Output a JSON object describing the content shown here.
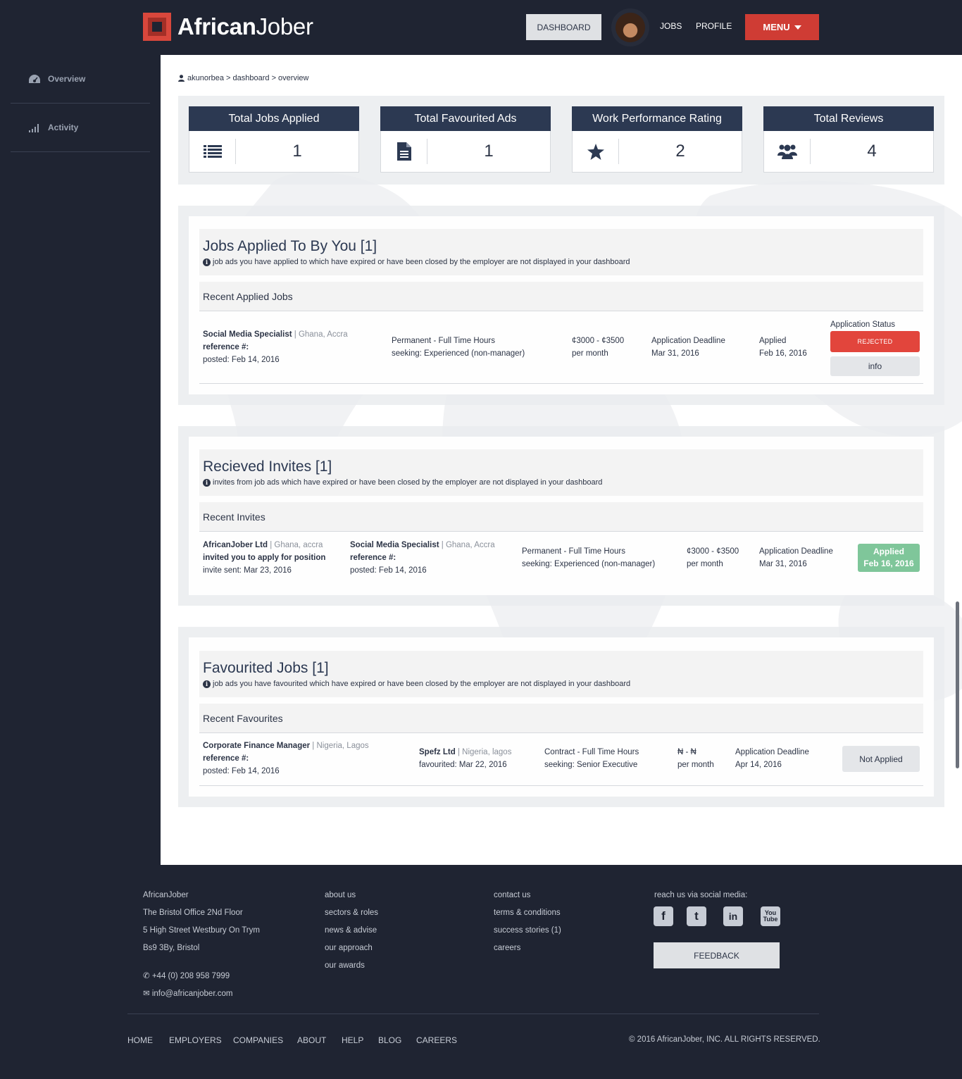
{
  "header": {
    "logo_text_bold": "African",
    "logo_text_light": "Jober",
    "nav_dashboard": "DASHBOARD",
    "nav_jobs": "JOBS",
    "nav_profile": "PROFILE",
    "nav_menu": "MENU"
  },
  "sidebar": {
    "items": [
      {
        "label": "Overview",
        "icon": "dashboard-icon"
      },
      {
        "label": "Activity",
        "icon": "signal-bars-icon"
      }
    ]
  },
  "breadcrumb": "akunorbea > dashboard > overview",
  "stats": [
    {
      "title": "Total Jobs Applied",
      "value": "1",
      "icon": "list-icon"
    },
    {
      "title": "Total Favourited Ads",
      "value": "1",
      "icon": "document-icon"
    },
    {
      "title": "Work Performance Rating",
      "value": "2",
      "icon": "star-icon"
    },
    {
      "title": "Total Reviews",
      "value": "4",
      "icon": "users-icon"
    }
  ],
  "applied": {
    "title": "Jobs Applied To By You [1]",
    "note": "job ads you have applied to which have expired or have been closed by the employer are not displayed in your dashboard",
    "subtitle": "Recent Applied Jobs",
    "row": {
      "job_title": "Social Media Specialist",
      "location": "| Ghana, Accra",
      "reference": "reference #:",
      "posted": "posted: Feb 14, 2016",
      "type": "Permanent - Full Time Hours",
      "seeking": "seeking: Experienced (non-manager)",
      "salary": "¢3000 - ¢3500",
      "salary_period": "per month",
      "deadline_label": "Application Deadline",
      "deadline": "Mar 31, 2016",
      "applied_label": "Applied",
      "applied_date": "Feb 16, 2016",
      "status_label": "Application Status",
      "status": "REJECTED",
      "info_button": "info"
    }
  },
  "invites": {
    "title": "Recieved Invites [1]",
    "note": "invites from job ads which have expired or have been closed by the employer are not displayed in your dashboard",
    "subtitle": "Recent Invites",
    "row": {
      "company": "AfricanJober Ltd",
      "company_location": "| Ghana, accra",
      "invite_text": "invited you to apply for position",
      "invite_sent": "invite sent: Mar 23, 2016",
      "job_title": "Social Media Specialist",
      "location": "| Ghana, Accra",
      "reference": "reference #:",
      "posted": "posted: Feb 14, 2016",
      "type": "Permanent - Full Time Hours",
      "seeking": "seeking: Experienced (non-manager)",
      "salary": "¢3000 - ¢3500",
      "salary_period": "per month",
      "deadline_label": "Application Deadline",
      "deadline": "Mar 31, 2016",
      "applied_label": "Applied",
      "applied_date": "Feb 16, 2016"
    }
  },
  "favourites": {
    "title": "Favourited Jobs [1]",
    "note": "job ads you have favourited which have expired or have been closed by the employer are not displayed in your dashboard",
    "subtitle": "Recent Favourites",
    "row": {
      "job_title": "Corporate Finance Manager",
      "location": "| Nigeria, Lagos",
      "reference": "reference #:",
      "posted": "posted: Feb 14, 2016",
      "company": "Spefz Ltd",
      "company_location": "| Nigeria, lagos",
      "favourited": "favourited: Mar 22, 2016",
      "type": "Contract - Full Time Hours",
      "seeking": "seeking: Senior Executive",
      "salary": "₦ - ₦",
      "salary_period": "per month",
      "deadline_label": "Application Deadline",
      "deadline": "Apr 14, 2016",
      "status_button": "Not Applied"
    }
  },
  "footer": {
    "address": [
      "AfricanJober",
      "The Bristol Office 2Nd Floor",
      "5 High Street Westbury On Trym",
      "Bs9 3By, Bristol"
    ],
    "phone": "+44 (0) 208 958 7999",
    "email": "info@africanjober.com",
    "links_col1": [
      "about us",
      "sectors & roles",
      "news & advise",
      "our approach",
      "our awards"
    ],
    "links_col2": [
      "contact us",
      "terms & conditions",
      "success stories (1)",
      "careers"
    ],
    "social_label": "reach us via social media:",
    "social_icons": [
      "facebook-icon",
      "twitter-icon",
      "linkedin-icon",
      "youtube-icon"
    ],
    "feedback": "FEEDBACK",
    "nav": [
      "HOME",
      "EMPLOYERS",
      "COMPANIES",
      "ABOUT",
      "HELP",
      "BLOG",
      "CAREERS"
    ],
    "copyright": "© 2016 AfricanJober, INC. ALL RIGHTS RESERVED."
  },
  "colors": {
    "dark": "#1f2432",
    "navy": "#2c3952",
    "brand_red": "#cf3c34",
    "rejected_red": "#e2453c",
    "applied_green": "#7fc69a"
  }
}
